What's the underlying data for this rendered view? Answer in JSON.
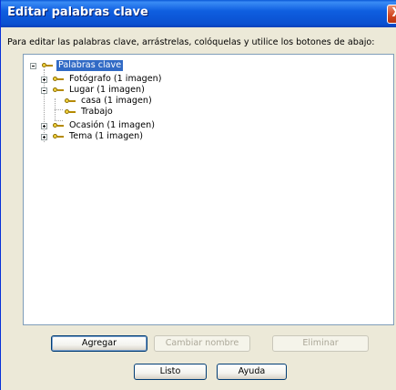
{
  "window": {
    "title": "Editar palabras clave",
    "close_glyph": "X"
  },
  "instructions": "Para editar las palabras clave, arrástrelas, colóquelas y utilice los botones de abajo:",
  "tree": {
    "root": {
      "label": "Palabras clave",
      "expanded": true,
      "selected": true
    },
    "items": [
      {
        "label": "Fotógrafo (1 imagen)",
        "expander": "plus"
      },
      {
        "label": "Lugar (1 imagen)",
        "expander": "minus"
      },
      {
        "label": "casa (1 imagen)",
        "expander": "none"
      },
      {
        "label": "Trabajo",
        "expander": "none"
      },
      {
        "label": "Ocasión (1 imagen)",
        "expander": "plus"
      },
      {
        "label": "Tema (1 imagen)",
        "expander": "plus"
      }
    ]
  },
  "buttons": {
    "add": "Agregar",
    "rename": "Cambiar nombre",
    "delete": "Eliminar",
    "done": "Listo",
    "help": "Ayuda"
  },
  "colors": {
    "titlebar": "#0a50d0",
    "selection": "#316ac5",
    "window_bg": "#ece9d8"
  },
  "icons": [
    "key-icon",
    "close-icon",
    "expand-icon",
    "collapse-icon"
  ]
}
